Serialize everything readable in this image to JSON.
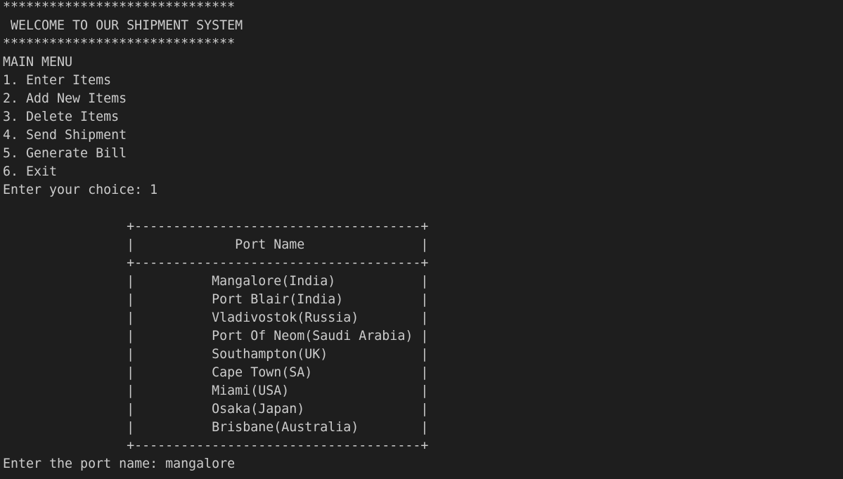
{
  "terminal": {
    "banner_top": "******************************",
    "welcome": " WELCOME TO OUR SHIPMENT SYSTEM",
    "banner_bottom": "******************************",
    "menu_title": "MAIN MENU",
    "menu_items": [
      "1. Enter Items",
      "2. Add New Items",
      "3. Delete Items",
      "4. Send Shipment",
      "5. Generate Bill",
      "6. Exit"
    ],
    "choice_prompt": "Enter your choice: 1",
    "table": {
      "border_top": "                +-------------------------------------+",
      "header": "                |             Port Name               |",
      "border_mid": "                +-------------------------------------+",
      "rows": [
        "                |          Mangalore(India)           |",
        "                |          Port Blair(India)          |",
        "                |          Vladivostok(Russia)        |",
        "                |          Port Of Neom(Saudi Arabia) |",
        "                |          Southampton(UK)            |",
        "                |          Cape Town(SA)              |",
        "                |          Miami(USA)                 |",
        "                |          Osaka(Japan)               |",
        "                |          Brisbane(Australia)        |"
      ],
      "border_bottom": "                +-------------------------------------+"
    },
    "port_prompt": "Enter the port name: mangalore"
  }
}
